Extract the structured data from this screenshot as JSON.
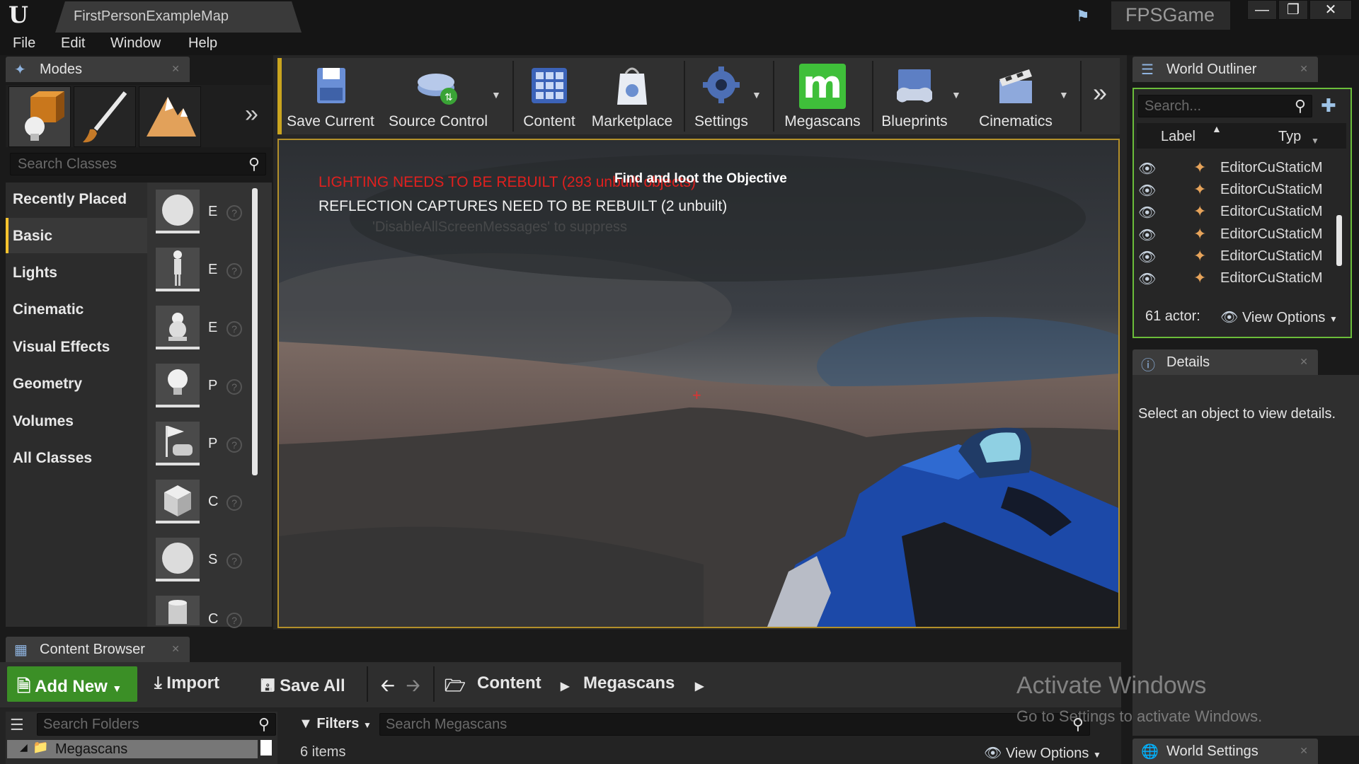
{
  "window": {
    "tab_title": "FirstPersonExampleMap",
    "project": "FPSGame",
    "controls": [
      "—",
      "❐",
      "✕"
    ]
  },
  "menu": [
    "File",
    "Edit",
    "Window",
    "Help"
  ],
  "modes": {
    "tab_label": "Modes",
    "search_placeholder": "Search Classes",
    "categories": [
      "Recently Placed",
      "Basic",
      "Lights",
      "Cinematic",
      "Visual Effects",
      "Geometry",
      "Volumes",
      "All Classes"
    ],
    "active_category": "Basic",
    "items": [
      {
        "letter": "E",
        "icon": "sphere-icon"
      },
      {
        "letter": "E",
        "icon": "character-icon"
      },
      {
        "letter": "E",
        "icon": "pawn-icon"
      },
      {
        "letter": "P",
        "icon": "light-bulb-icon"
      },
      {
        "letter": "P",
        "icon": "player-start-icon"
      },
      {
        "letter": "C",
        "icon": "cube-icon"
      },
      {
        "letter": "S",
        "icon": "sphere-icon"
      },
      {
        "letter": "C",
        "icon": "cylinder-icon"
      }
    ]
  },
  "toolbar": {
    "buttons": [
      {
        "label": "Save Current",
        "icon": "save-icon"
      },
      {
        "label": "Source Control",
        "icon": "source-control-icon"
      },
      {
        "label": "Content",
        "icon": "content-icon"
      },
      {
        "label": "Marketplace",
        "icon": "marketplace-icon"
      },
      {
        "label": "Settings",
        "icon": "settings-icon"
      },
      {
        "label": "Megascans",
        "icon": "megascans-icon"
      },
      {
        "label": "Blueprints",
        "icon": "blueprints-icon"
      },
      {
        "label": "Cinematics",
        "icon": "cinematics-icon"
      }
    ],
    "megascans_letter": "m"
  },
  "viewport": {
    "lighting_warning": "LIGHTING NEEDS TO BE REBUILT (293 unbuilt objects)",
    "reflection_warning": "REFLECTION CAPTURES NEED TO BE REBUILT (2 unbuilt)",
    "suppress_hint": "'DisableAllScreenMessages' to suppress",
    "objective": "Find and loot the Objective",
    "crosshair": "+"
  },
  "world_outliner": {
    "tab_label": "World Outliner",
    "search_placeholder": "Search...",
    "col_label": "Label",
    "col_type": "Typ",
    "rows": [
      {
        "label": "EditorCu",
        "type": "StaticM"
      },
      {
        "label": "EditorCu",
        "type": "StaticM"
      },
      {
        "label": "EditorCu",
        "type": "StaticM"
      },
      {
        "label": "EditorCu",
        "type": "StaticM"
      },
      {
        "label": "EditorCu",
        "type": "StaticM"
      },
      {
        "label": "EditorCu",
        "type": "StaticM"
      }
    ],
    "actor_count": "61 actor:",
    "view_options": "View Options"
  },
  "details": {
    "tab_label": "Details",
    "empty_message": "Select an object to view details."
  },
  "world_settings": {
    "tab_label": "World Settings"
  },
  "content_browser": {
    "tab_label": "Content Browser",
    "add_new": "Add New",
    "import": "Import",
    "save_all": "Save All",
    "breadcrumb": [
      "Content",
      "Megascans"
    ],
    "search_folders_placeholder": "Search Folders",
    "folder": "Megascans",
    "filters": "Filters",
    "search_placeholder": "Search Megascans",
    "item_count": "6 items",
    "view_options": "View Options"
  },
  "watermark": {
    "title": "Activate Windows",
    "subtitle": "Go to Settings to activate Windows."
  },
  "colors": {
    "accent_yellow": "#ffc42e",
    "viewport_border": "#b3902a",
    "add_new_green": "#3b8f26",
    "outliner_border": "#6bbd3a",
    "warning_red": "#e0201e"
  }
}
